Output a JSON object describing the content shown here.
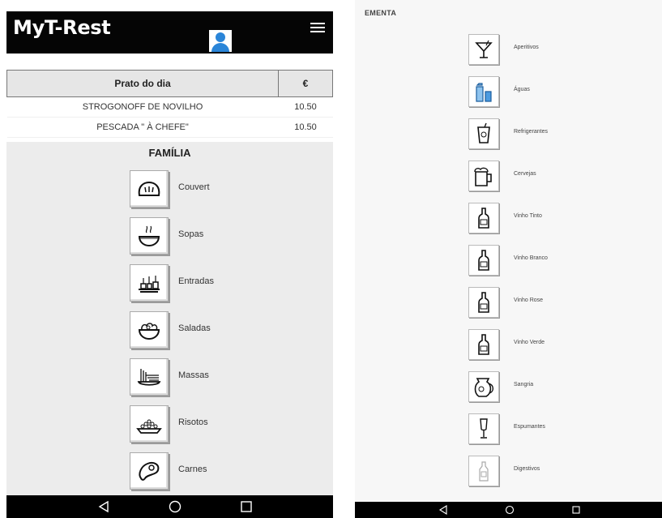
{
  "app": {
    "title": "MyT-Rest"
  },
  "dish_table": {
    "col_dish": "Prato do dia",
    "col_price": "€",
    "rows": [
      {
        "dish": "STROGONOFF DE NOVILHO",
        "price": "10.50"
      },
      {
        "dish": "PESCADA \" À CHEFE\"",
        "price": "10.50"
      }
    ]
  },
  "family": {
    "title": "FAMÍLIA",
    "items": [
      {
        "label": "Couvert",
        "icon": "bread-icon"
      },
      {
        "label": "Sopas",
        "icon": "soup-bowl-icon"
      },
      {
        "label": "Entradas",
        "icon": "appetizers-icon"
      },
      {
        "label": "Saladas",
        "icon": "salad-bowl-icon"
      },
      {
        "label": "Massas",
        "icon": "pasta-icon"
      },
      {
        "label": "Risotos",
        "icon": "risotto-icon"
      },
      {
        "label": "Carnes",
        "icon": "steak-icon"
      }
    ]
  },
  "menu": {
    "title": "EMENTA",
    "items": [
      {
        "label": "Aperitivos",
        "icon": "cocktail-icon"
      },
      {
        "label": "Águas",
        "icon": "water-bottles-icon"
      },
      {
        "label": "Refrigerantes",
        "icon": "soda-cup-icon"
      },
      {
        "label": "Cervejas",
        "icon": "beer-mug-icon"
      },
      {
        "label": "Vinho Tinto",
        "icon": "wine-bottle-icon"
      },
      {
        "label": "Vinho Branco",
        "icon": "wine-bottle-icon"
      },
      {
        "label": "Vinho Rose",
        "icon": "wine-bottle-icon"
      },
      {
        "label": "Vinho Verde",
        "icon": "wine-bottle-icon"
      },
      {
        "label": "Sangria",
        "icon": "sangria-jug-icon"
      },
      {
        "label": "Espumantes",
        "icon": "champagne-glass-icon"
      },
      {
        "label": "Digestivos",
        "icon": "liqueur-bottle-icon"
      }
    ]
  },
  "colors": {
    "header": "#050505",
    "avatar": "#2a85d8",
    "panel": "#ececec"
  }
}
